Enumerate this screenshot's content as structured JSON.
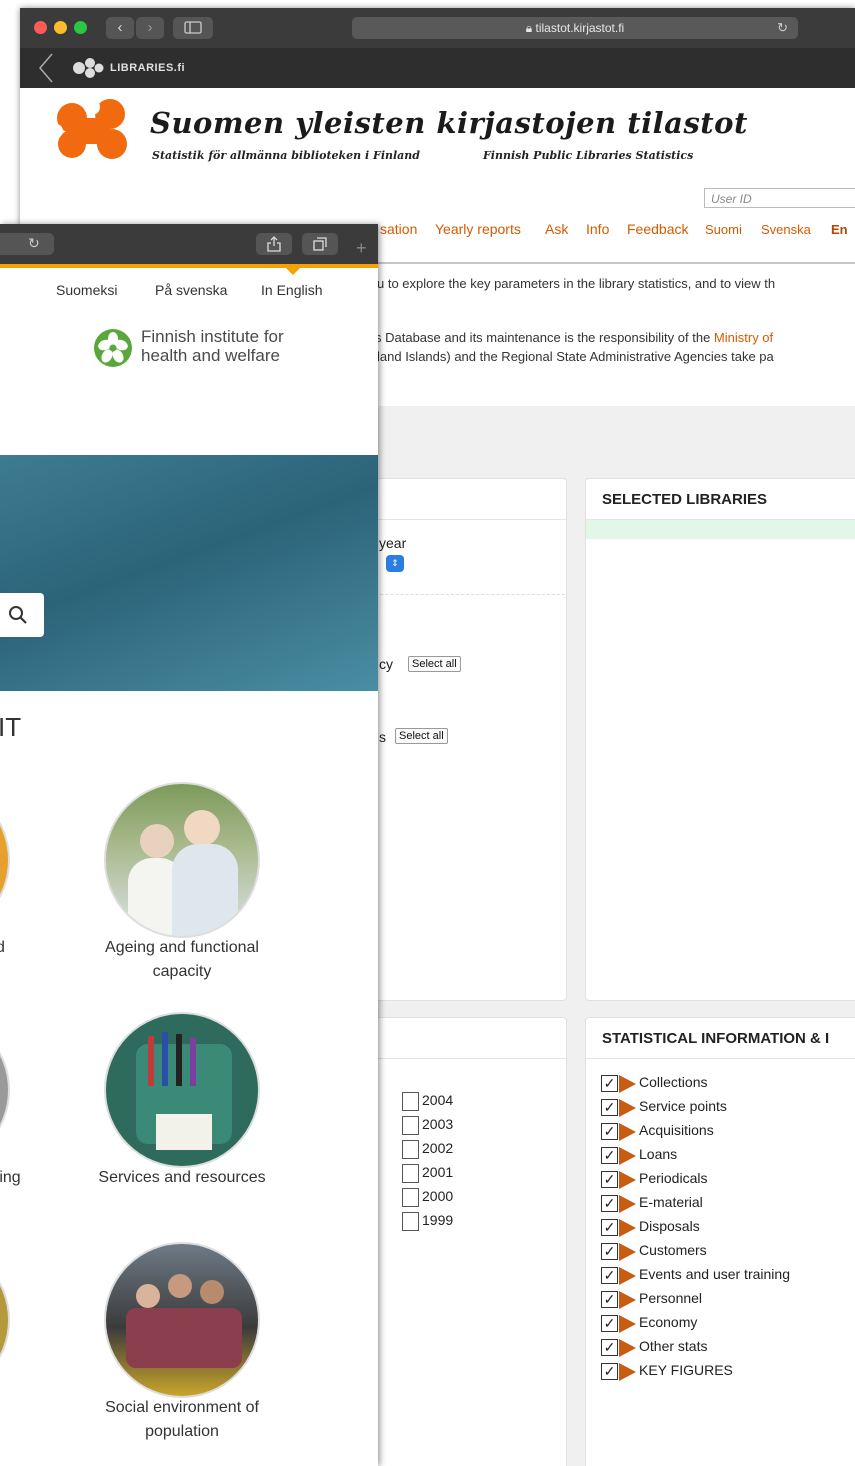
{
  "back_window": {
    "url": "tilastot.kirjastot.fi",
    "brand_bar": "LIBRARIES.fi",
    "site_title": "Suomen yleisten kirjastojen tilastot",
    "subtitle_sv": "Statistik för allmänna biblioteken i Finland",
    "subtitle_en": "Finnish Public Libraries Statistics",
    "user_id_placeholder": "User ID",
    "menu": [
      "sation",
      "Yearly reports",
      "Ask",
      "Info",
      "Feedback",
      "Suomi",
      "Svenska",
      "En"
    ],
    "intro_line1": "u to explore the key parameters in the library statistics, and to view th",
    "intro_line2_pre": "s Database and its maintenance is the responsibility of the ",
    "intro_line2_link": "Ministry of",
    "intro_line3": "land Islands) and the Regional State Administrative Agencies take pa",
    "left_panel": {
      "year_label": "year",
      "agency_label": "cy",
      "munic_label": "s",
      "select_all": "Select all"
    },
    "selected_libraries_title": "SELECTED LIBRARIES",
    "years": [
      "2004",
      "2003",
      "2002",
      "2001",
      "2000",
      "1999"
    ],
    "stat_panel_title": "STATISTICAL INFORMATION & I",
    "stat_items": [
      "Collections",
      "Service points",
      "Acquisitions",
      "Loans",
      "Periodicals",
      "E-material",
      "Disposals",
      "Customers",
      "Events and user training",
      "Personnel",
      "Economy",
      "Other stats",
      "KEY FIGURES"
    ]
  },
  "front_window": {
    "languages": [
      "Suomeksi",
      "På svenska",
      "In English"
    ],
    "org_line1": "Finnish institute for",
    "org_line2": "health and welfare",
    "section_heading_fragment": "IT",
    "topics": [
      {
        "left": "d",
        "right_line1": "Ageing and functional",
        "right_line2": "capacity"
      },
      {
        "left": "ring",
        "right_line1": "Services and resources",
        "right_line2": ""
      },
      {
        "left": "",
        "right_line1": "Social environment of",
        "right_line2": "population"
      }
    ]
  },
  "colors": {
    "accent_orange": "#d65a00",
    "thl_green": "#5aa83c",
    "checkbox_triangle": "#c95b13"
  }
}
